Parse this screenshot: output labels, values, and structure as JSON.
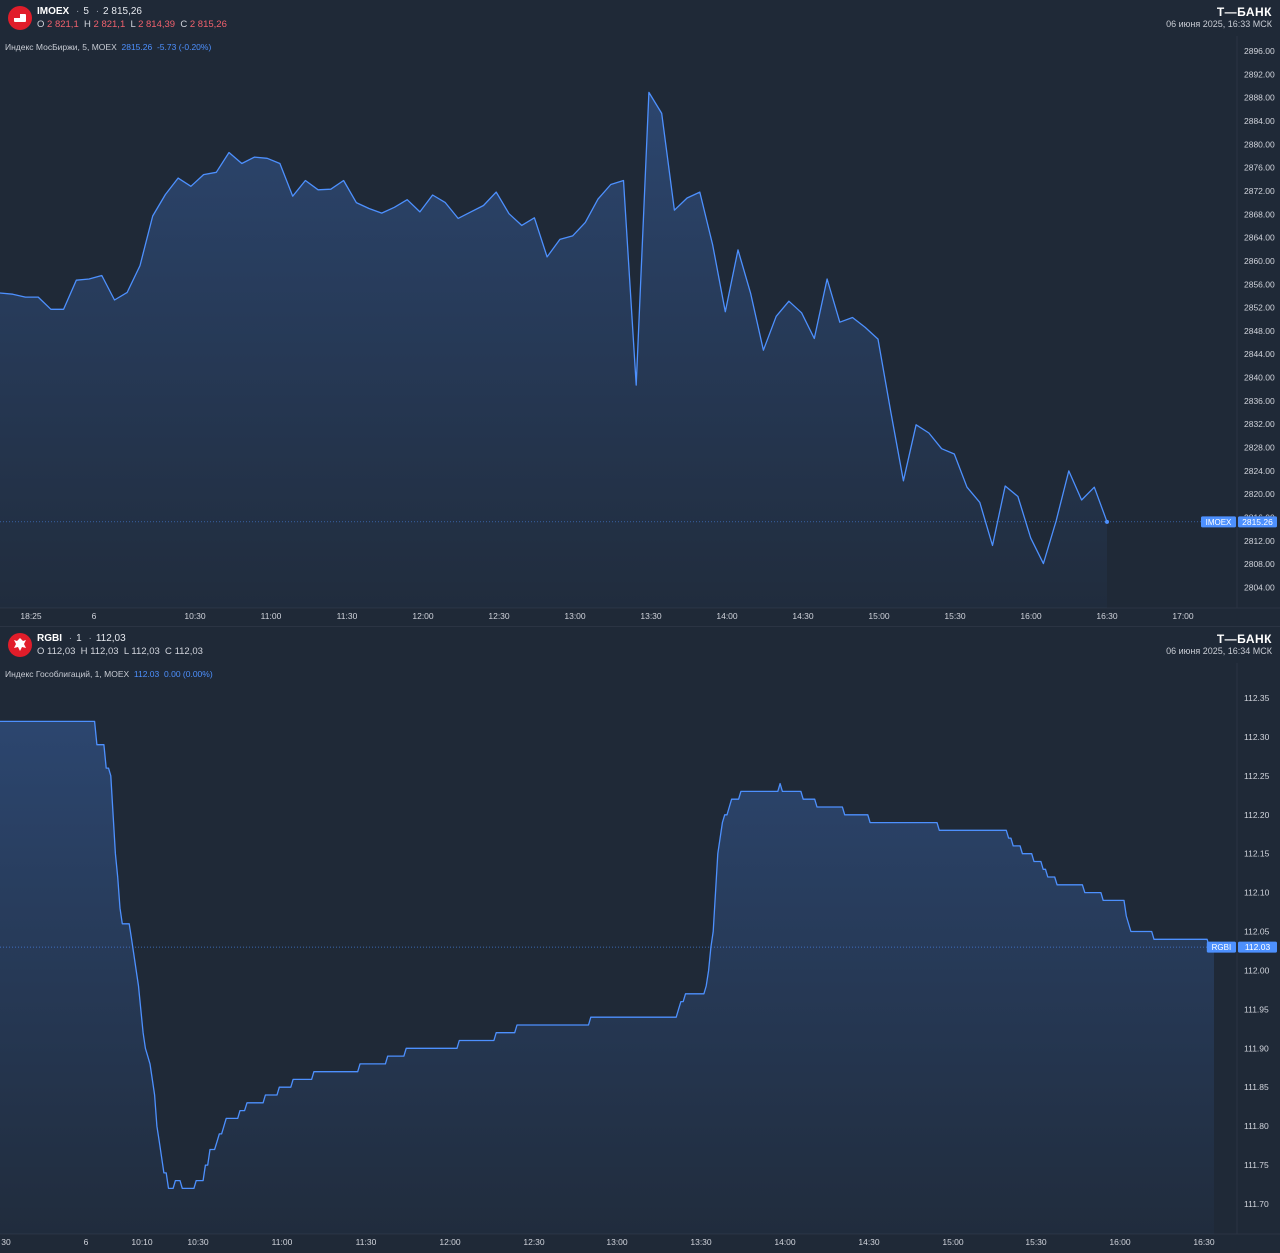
{
  "panels": [
    {
      "header": {
        "symbol": "IMOEX",
        "interval": "5",
        "price": "2 815,26",
        "o_label": "O",
        "o_value": "2 821,1",
        "h_label": "H",
        "h_value": "2 821,1",
        "l_label": "L",
        "l_value": "2 814,39",
        "c_label": "C",
        "c_value": "2 815,26",
        "indicator_name": "Индекс МосБиржи, 5, MOEX",
        "indicator_value": "2815.26",
        "indicator_change": "-5.73 (-0.20%)",
        "brand": "Т—БАНК",
        "datetime": "06 июня 2025, 16:33 МСК"
      },
      "colors": {
        "line": "#4d90fe",
        "down": "#f0616d",
        "background": "#1f2937",
        "logo": "#e11d2a"
      }
    },
    {
      "header": {
        "symbol": "RGBI",
        "interval": "1",
        "price": "112,03",
        "o_label": "O",
        "o_value": "112,03",
        "h_label": "H",
        "h_value": "112,03",
        "l_label": "L",
        "l_value": "112,03",
        "c_label": "C",
        "c_value": "112,03",
        "indicator_name": "Индекс Гособлигаций, 1, MOEX",
        "indicator_value": "112.03",
        "indicator_change": "0.00 (0.00%)",
        "brand": "Т—БАНК",
        "datetime": "06 июня 2025, 16:34 МСК"
      },
      "colors": {
        "line": "#4d90fe",
        "down": "#d1d4dc",
        "background": "#1f2937",
        "logo": "#e11d2a"
      }
    }
  ],
  "chart_data": [
    {
      "type": "area",
      "symbol": "IMOEX",
      "x_ticks": [
        "18:25",
        "6",
        "10:30",
        "11:00",
        "11:30",
        "12:00",
        "12:30",
        "13:00",
        "13:30",
        "14:00",
        "14:30",
        "15:00",
        "15:30",
        "16:00",
        "16:30",
        "17:00"
      ],
      "y_ticks": [
        "2896.00",
        "2892.00",
        "2888.00",
        "2884.00",
        "2880.00",
        "2876.00",
        "2872.00",
        "2868.00",
        "2864.00",
        "2860.00",
        "2856.00",
        "2852.00",
        "2848.00",
        "2844.00",
        "2840.00",
        "2836.00",
        "2832.00",
        "2828.00",
        "2824.00",
        "2820.00",
        "2816.00",
        "2812.00",
        "2808.00",
        "2804.00"
      ],
      "ylim": [
        2803,
        2898
      ],
      "last_value": 2815.26,
      "last_label": "2815.26",
      "last_tag": "IMOEX",
      "values": [
        2854.5,
        2854.3,
        2853.8,
        2853.8,
        2851.7,
        2851.7,
        2856.7,
        2856.9,
        2857.5,
        2853.3,
        2854.6,
        2859.2,
        2867.7,
        2871.4,
        2874.2,
        2872.8,
        2874.8,
        2875.2,
        2878.6,
        2876.7,
        2877.8,
        2877.6,
        2876.7,
        2871.1,
        2873.8,
        2872.2,
        2872.3,
        2873.8,
        2870.0,
        2869.0,
        2868.2,
        2869.2,
        2870.5,
        2868.4,
        2871.3,
        2870.0,
        2867.3,
        2868.4,
        2869.5,
        2871.8,
        2868.1,
        2866.1,
        2867.4,
        2860.7,
        2863.7,
        2864.3,
        2866.6,
        2870.6,
        2873.1,
        2873.8,
        2838.7,
        2888.9,
        2885.3,
        2868.7,
        2870.8,
        2871.8,
        2862.8,
        2851.3,
        2861.9,
        2854.4,
        2844.7,
        2850.5,
        2853.1,
        2851.1,
        2846.7,
        2856.9,
        2849.5,
        2850.3,
        2848.6,
        2846.6,
        2834.2,
        2822.3,
        2831.9,
        2830.5,
        2827.8,
        2826.9,
        2821.2,
        2818.6,
        2811.2,
        2821.4,
        2819.6,
        2812.5,
        2808.1,
        2815.4,
        2824.0,
        2819.0,
        2821.2,
        2815.26
      ]
    },
    {
      "type": "area",
      "symbol": "RGBI",
      "x_ticks": [
        "30",
        "6",
        "10:10",
        "10:30",
        "11:00",
        "11:30",
        "12:00",
        "12:30",
        "13:00",
        "13:30",
        "14:00",
        "14:30",
        "15:00",
        "15:30",
        "16:00",
        "16:30"
      ],
      "y_ticks": [
        "112.35",
        "112.30",
        "112.25",
        "112.20",
        "112.15",
        "112.10",
        "112.05",
        "112.00",
        "111.95",
        "111.90",
        "111.85",
        "111.80",
        "111.75",
        "111.70"
      ],
      "ylim": [
        111.68,
        112.38
      ],
      "last_value": 112.03,
      "last_label": "112.03",
      "last_tag": "RGBI",
      "values": [
        112.32,
        112.32,
        112.32,
        112.32,
        112.32,
        112.32,
        112.32,
        112.32,
        112.32,
        112.32,
        112.32,
        112.32,
        112.32,
        112.32,
        112.32,
        112.32,
        112.32,
        112.32,
        112.32,
        112.32,
        112.32,
        112.32,
        112.32,
        112.32,
        112.32,
        112.32,
        112.32,
        112.32,
        112.32,
        112.32,
        112.32,
        112.32,
        112.32,
        112.32,
        112.32,
        112.32,
        112.32,
        112.32,
        112.32,
        112.32,
        112.32,
        112.32,
        112.29,
        112.29,
        112.29,
        112.29,
        112.26,
        112.26,
        112.25,
        112.2,
        112.15,
        112.12,
        112.08,
        112.06,
        112.06,
        112.06,
        112.06,
        112.04,
        112.02,
        112.0,
        111.98,
        111.95,
        111.92,
        111.9,
        111.89,
        111.88,
        111.86,
        111.84,
        111.8,
        111.78,
        111.76,
        111.74,
        111.74,
        111.72,
        111.72,
        111.72,
        111.73,
        111.73,
        111.73,
        111.72,
        111.72,
        111.72,
        111.72,
        111.72,
        111.72,
        111.73,
        111.73,
        111.73,
        111.73,
        111.75,
        111.75,
        111.77,
        111.77,
        111.77,
        111.78,
        111.79,
        111.79,
        111.8,
        111.81,
        111.81,
        111.81,
        111.81,
        111.81,
        111.81,
        111.82,
        111.82,
        111.82,
        111.83,
        111.83,
        111.83,
        111.83,
        111.83,
        111.83,
        111.83,
        111.83,
        111.84,
        111.84,
        111.84,
        111.84,
        111.84,
        111.84,
        111.85,
        111.85,
        111.85,
        111.85,
        111.85,
        111.85,
        111.86,
        111.86,
        111.86,
        111.86,
        111.86,
        111.86,
        111.86,
        111.86,
        111.86,
        111.87,
        111.87,
        111.87,
        111.87,
        111.87,
        111.87,
        111.87,
        111.87,
        111.87,
        111.87,
        111.87,
        111.87,
        111.87,
        111.87,
        111.87,
        111.87,
        111.87,
        111.87,
        111.87,
        111.87,
        111.88,
        111.88,
        111.88,
        111.88,
        111.88,
        111.88,
        111.88,
        111.88,
        111.88,
        111.88,
        111.88,
        111.88,
        111.89,
        111.89,
        111.89,
        111.89,
        111.89,
        111.89,
        111.89,
        111.89,
        111.9,
        111.9,
        111.9,
        111.9,
        111.9,
        111.9,
        111.9,
        111.9,
        111.9,
        111.9,
        111.9,
        111.9,
        111.9,
        111.9,
        111.9,
        111.9,
        111.9,
        111.9,
        111.9,
        111.9,
        111.9,
        111.9,
        111.9,
        111.91,
        111.91,
        111.91,
        111.91,
        111.91,
        111.91,
        111.91,
        111.91,
        111.91,
        111.91,
        111.91,
        111.91,
        111.91,
        111.91,
        111.91,
        111.91,
        111.92,
        111.92,
        111.92,
        111.92,
        111.92,
        111.92,
        111.92,
        111.92,
        111.92,
        111.93,
        111.93,
        111.93,
        111.93,
        111.93,
        111.93,
        111.93,
        111.93,
        111.93,
        111.93,
        111.93,
        111.93,
        111.93,
        111.93,
        111.93,
        111.93,
        111.93,
        111.93,
        111.93,
        111.93,
        111.93,
        111.93,
        111.93,
        111.93,
        111.93,
        111.93,
        111.93,
        111.93,
        111.93,
        111.93,
        111.93,
        111.93,
        111.94,
        111.94,
        111.94,
        111.94,
        111.94,
        111.94,
        111.94,
        111.94,
        111.94,
        111.94,
        111.94,
        111.94,
        111.94,
        111.94,
        111.94,
        111.94,
        111.94,
        111.94,
        111.94,
        111.94,
        111.94,
        111.94,
        111.94,
        111.94,
        111.94,
        111.94,
        111.94,
        111.94,
        111.94,
        111.94,
        111.94,
        111.94,
        111.94,
        111.94,
        111.94,
        111.94,
        111.94,
        111.94,
        111.95,
        111.96,
        111.96,
        111.97,
        111.97,
        111.97,
        111.97,
        111.97,
        111.97,
        111.97,
        111.97,
        111.97,
        111.98,
        112.0,
        112.03,
        112.05,
        112.1,
        112.15,
        112.17,
        112.19,
        112.2,
        112.2,
        112.21,
        112.22,
        112.22,
        112.22,
        112.22,
        112.23,
        112.23,
        112.23,
        112.23,
        112.23,
        112.23,
        112.23,
        112.23,
        112.23,
        112.23,
        112.23,
        112.23,
        112.23,
        112.23,
        112.23,
        112.23,
        112.23,
        112.24,
        112.23,
        112.23,
        112.23,
        112.23,
        112.23,
        112.23,
        112.23,
        112.23,
        112.23,
        112.22,
        112.22,
        112.22,
        112.22,
        112.22,
        112.22,
        112.21,
        112.21,
        112.21,
        112.21,
        112.21,
        112.21,
        112.21,
        112.21,
        112.21,
        112.21,
        112.21,
        112.21,
        112.2,
        112.2,
        112.2,
        112.2,
        112.2,
        112.2,
        112.2,
        112.2,
        112.2,
        112.2,
        112.2,
        112.19,
        112.19,
        112.19,
        112.19,
        112.19,
        112.19,
        112.19,
        112.19,
        112.19,
        112.19,
        112.19,
        112.19,
        112.19,
        112.19,
        112.19,
        112.19,
        112.19,
        112.19,
        112.19,
        112.19,
        112.19,
        112.19,
        112.19,
        112.19,
        112.19,
        112.19,
        112.19,
        112.19,
        112.19,
        112.19,
        112.18,
        112.18,
        112.18,
        112.18,
        112.18,
        112.18,
        112.18,
        112.18,
        112.18,
        112.18,
        112.18,
        112.18,
        112.18,
        112.18,
        112.18,
        112.18,
        112.18,
        112.18,
        112.18,
        112.18,
        112.18,
        112.18,
        112.18,
        112.18,
        112.18,
        112.18,
        112.18,
        112.18,
        112.18,
        112.18,
        112.17,
        112.17,
        112.16,
        112.16,
        112.16,
        112.16,
        112.15,
        112.15,
        112.15,
        112.15,
        112.15,
        112.14,
        112.14,
        112.14,
        112.14,
        112.13,
        112.13,
        112.12,
        112.12,
        112.12,
        112.12,
        112.11,
        112.11,
        112.11,
        112.11,
        112.11,
        112.11,
        112.11,
        112.11,
        112.11,
        112.11,
        112.11,
        112.11,
        112.1,
        112.1,
        112.1,
        112.1,
        112.1,
        112.1,
        112.1,
        112.1,
        112.09,
        112.09,
        112.09,
        112.09,
        112.09,
        112.09,
        112.09,
        112.09,
        112.09,
        112.09,
        112.07,
        112.06,
        112.05,
        112.05,
        112.05,
        112.05,
        112.05,
        112.05,
        112.05,
        112.05,
        112.05,
        112.05,
        112.04,
        112.04,
        112.04,
        112.04,
        112.04,
        112.04,
        112.04,
        112.04,
        112.04,
        112.04,
        112.04,
        112.04,
        112.04,
        112.04,
        112.04,
        112.04,
        112.04,
        112.04,
        112.04,
        112.04,
        112.04,
        112.04,
        112.04,
        112.04,
        112.03,
        112.03,
        112.03
      ]
    }
  ]
}
